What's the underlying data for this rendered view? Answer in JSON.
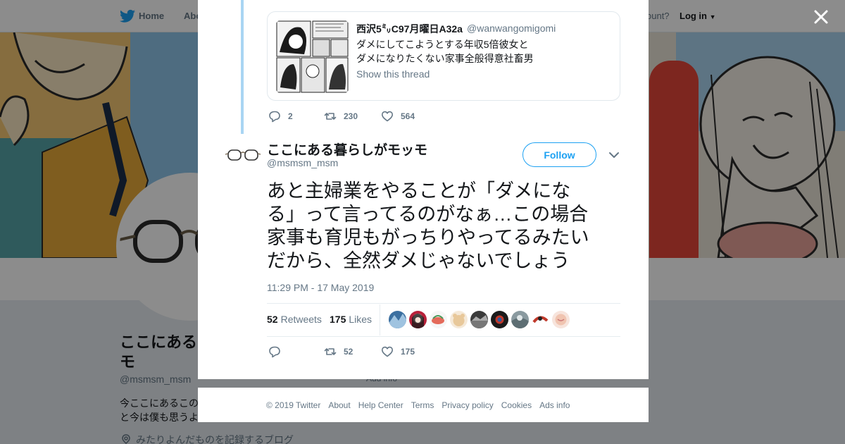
{
  "nav": {
    "home": "Home",
    "about": "Abo",
    "account": "ccount?",
    "login": "Log in"
  },
  "background_profile": {
    "name_line1": "ここにある",
    "name_line2": "モ",
    "handle": "@msmsm_msm",
    "bio_line1": "今ここにあるこの",
    "bio_line2": "と今は僕も思うよ",
    "link": "みたりよんだものを記録するブログ",
    "add_info": "Add info"
  },
  "quoted_tweet": {
    "author": "西沢5㍉C97月曜日A32a",
    "handle": "@wanwangomigomi",
    "line1": "ダメにしてこようとする年収5倍彼女と",
    "line2": "ダメになりたくない家事全般得意社畜男",
    "show_thread": "Show this thread",
    "replies": "2",
    "retweets": "230",
    "likes": "564"
  },
  "tweet": {
    "name": "ここにある暮らしがモッモ",
    "handle": "@msmsm_msm",
    "follow_label": "Follow",
    "text_lines": [
      "あと主婦業をやることが「ダメにな",
      "る」って言ってるのがなぁ…この場合",
      "家事も育児もがっちりやってるみたい",
      "だから、全然ダメじゃないでしょう"
    ],
    "timestamp": "11:29 PM - 17 May 2019",
    "retweet_count": "52",
    "retweets_label": "Retweets",
    "like_count": "175",
    "likes_label": "Likes",
    "action_retweets": "52",
    "action_likes": "175"
  },
  "footer": {
    "copyright": "© 2019 Twitter",
    "about": "About",
    "help": "Help Center",
    "terms": "Terms",
    "privacy": "Privacy policy",
    "cookies": "Cookies",
    "ads": "Ads info"
  },
  "icons": {
    "close": "close-icon",
    "reply": "reply-icon",
    "retweet": "retweet-icon",
    "like": "heart-icon",
    "caret": "chevron-down-icon",
    "bird": "twitter-bird-icon",
    "location": "location-pin-icon"
  },
  "colors": {
    "brand": "#1da1f2",
    "muted": "#657786",
    "thread_line": "#a9d5f3"
  }
}
